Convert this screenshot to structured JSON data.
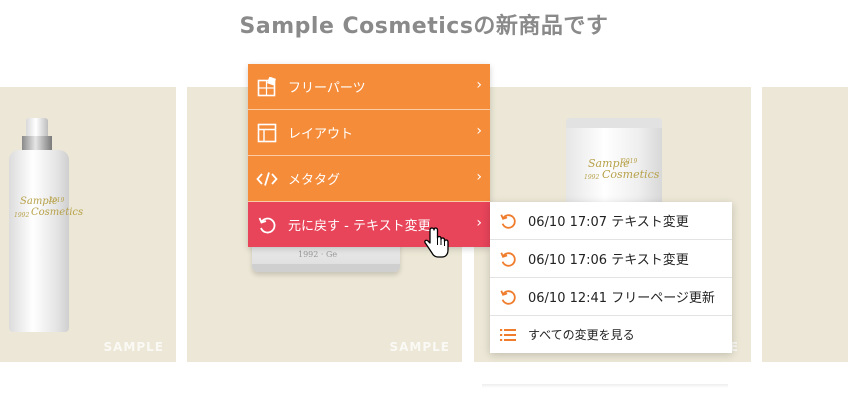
{
  "header": {
    "title": "Sample Cosmeticsの新商品です"
  },
  "products": {
    "watermark": "SAMPLE",
    "label_small": "1992",
    "label_year": "2019",
    "label_brand1": "Sample",
    "label_brand2": "Cosmetics",
    "jar_label": "1992 · Ge"
  },
  "menu": {
    "items": [
      {
        "label": "フリーパーツ",
        "icon": "puzzle-piece-icon"
      },
      {
        "label": "レイアウト",
        "icon": "layout-icon"
      },
      {
        "label": "メタタグ",
        "icon": "code-icon"
      },
      {
        "label": "元に戻す - テキスト変更",
        "icon": "undo-icon",
        "active": true
      }
    ],
    "chevron": "›"
  },
  "history": {
    "items": [
      {
        "label": "06/10 17:07 テキスト変更",
        "icon": "undo-icon"
      },
      {
        "label": "06/10 17:06 テキスト変更",
        "icon": "undo-icon"
      },
      {
        "label": "06/10 12:41 フリーページ更新",
        "icon": "undo-icon"
      }
    ],
    "see_all": {
      "label": "すべての変更を見る",
      "icon": "list-icon"
    }
  },
  "colors": {
    "menu_orange": "#f58c3a",
    "menu_active_red": "#e8445a",
    "card_beige": "#ece7d6",
    "title_gray": "#8a8a8a",
    "icon_orange": "#f07d2d"
  }
}
